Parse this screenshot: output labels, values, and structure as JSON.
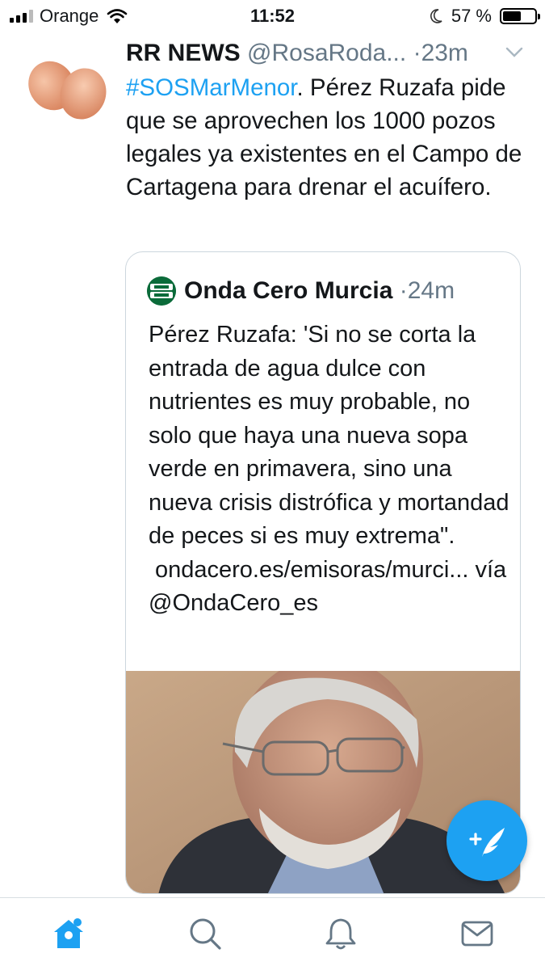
{
  "status_bar": {
    "carrier": "Orange",
    "time": "11:52",
    "battery": "57 %",
    "battery_level": 0.57,
    "icons": [
      "signal-icon",
      "wifi-icon",
      "moon-icon",
      "battery-icon"
    ]
  },
  "tweet": {
    "name": "RR NEWS",
    "handle": "@RosaRoda...",
    "separator": " ·",
    "time": "23m",
    "hashtag": "#SOSMarMenor",
    "text": ". Pérez Ruzafa pide que se aprovechen los 1000 pozos legales ya existentes en el Campo de Cartagena para drenar el acuífero."
  },
  "quote": {
    "name": "Onda Cero Murcia",
    "separator": "·",
    "time": "24m",
    "text": "Pérez Ruzafa: 'Si no se corta la entrada de agua dulce con nutrientes es muy probable, no solo que haya una nueva sopa verde en primavera, sino una nueva crisis distrófica y mortandad de peces si es muy extrema\".",
    "link": "ondacero.es/emisoras/murci... vía @OndaCero_es"
  },
  "tabs": [
    {
      "name": "home",
      "icon": "home-icon"
    },
    {
      "name": "search",
      "icon": "search-icon"
    },
    {
      "name": "notifications",
      "icon": "bell-icon"
    },
    {
      "name": "messages",
      "icon": "mail-icon"
    }
  ],
  "colors": {
    "accent": "#1da1f2",
    "secondary_text": "#657786",
    "border": "#ccd6dd"
  }
}
